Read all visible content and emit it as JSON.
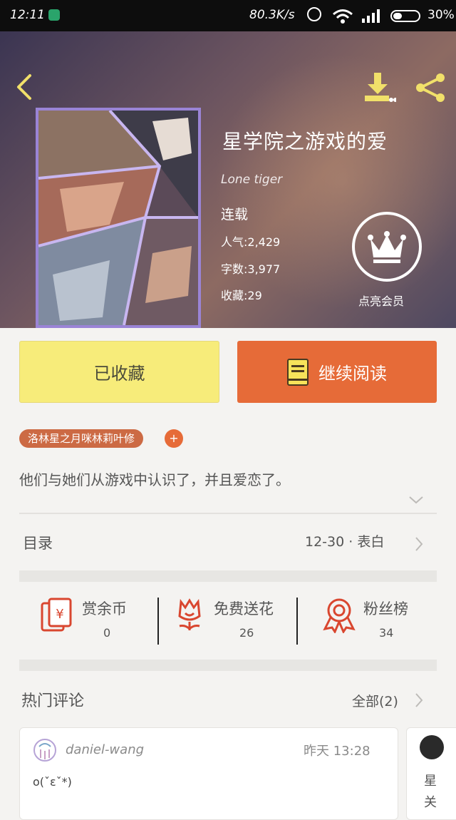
{
  "status_bar": {
    "time": "12:11",
    "speed": "80.3K/s",
    "battery": "30%"
  },
  "book": {
    "title": "星学院之游戏的爱",
    "author": "Lone tiger",
    "status": "连载",
    "popularity": "人气:2,429",
    "word_count": "字数:3,977",
    "favorites": "收藏:29"
  },
  "vip": {
    "label": "点亮会员"
  },
  "actions": {
    "favorited_label": "已收藏",
    "continue_label": "继续阅读"
  },
  "tag": {
    "label": "洛林星之月咪林莉叶修",
    "add": "+"
  },
  "intro": "他们与她们从游戏中认识了，并且爱恋了。",
  "toc": {
    "label": "目录",
    "latest": "12-30 · 表白"
  },
  "stats": [
    {
      "label": "赏余币",
      "value": "0"
    },
    {
      "label": "免费送花",
      "value": "26"
    },
    {
      "label": "粉丝榜",
      "value": "34"
    }
  ],
  "hot_comments": {
    "title": "热门评论",
    "all_label": "全部(2)",
    "items": [
      {
        "user": "daniel-wang",
        "time": "昨天 13:28",
        "text": "o(ˇεˇ*)"
      },
      {
        "text": "星关"
      }
    ]
  },
  "colors": {
    "accent": "#e66b38",
    "favorite_bg": "#f7ec7a",
    "tag_bg": "#cc6a44"
  }
}
